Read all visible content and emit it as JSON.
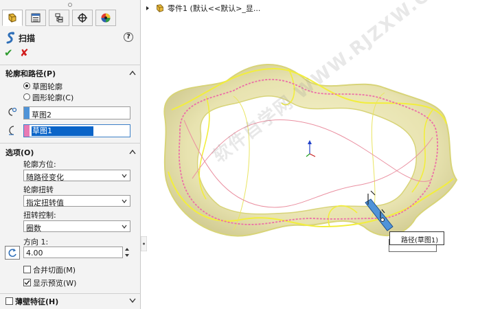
{
  "property_manager": {
    "tabs": [
      {
        "icon": "feature-manager-icon",
        "active": true
      },
      {
        "icon": "property-manager-icon",
        "active": false
      },
      {
        "icon": "configuration-manager-icon",
        "active": false
      },
      {
        "icon": "dimxpert-icon",
        "active": false
      },
      {
        "icon": "display-manager-icon",
        "active": false
      }
    ],
    "title": "扫描",
    "help": "?",
    "ok": "✔",
    "cancel": "✘",
    "profile_path": {
      "title": "轮廓和路径(P)",
      "options": [
        {
          "label": "草图轮廓",
          "checked": true
        },
        {
          "label": "圆形轮廓(C)",
          "checked": false
        }
      ],
      "profile_value": "草图2",
      "profile_color": "#4f93d8",
      "path_value": "草图1",
      "path_color": "#e87ab4"
    },
    "options": {
      "title": "选项(O)",
      "orientation_label": "轮廓方位:",
      "orientation_value": "随路径变化",
      "twist_label": "轮廓扭转",
      "twist_value": "指定扭转值",
      "twist_control_label": "扭转控制:",
      "twist_control_value": "圈数",
      "direction_label": "方向 1:",
      "direction_value": "4.00",
      "merge_tangent_label": "合并切面(M)",
      "merge_tangent_checked": false,
      "show_preview_label": "显示预览(W)",
      "show_preview_checked": true
    },
    "thin_feature": {
      "label": "薄壁特征(H)",
      "checked": false
    }
  },
  "graphics": {
    "tree_item": "零件1  (默认<<默认>_显...",
    "callout": "路径(草图1)",
    "callout_shadow": "",
    "watermark": "软件自学网 WWW.RJZXW.COM"
  }
}
